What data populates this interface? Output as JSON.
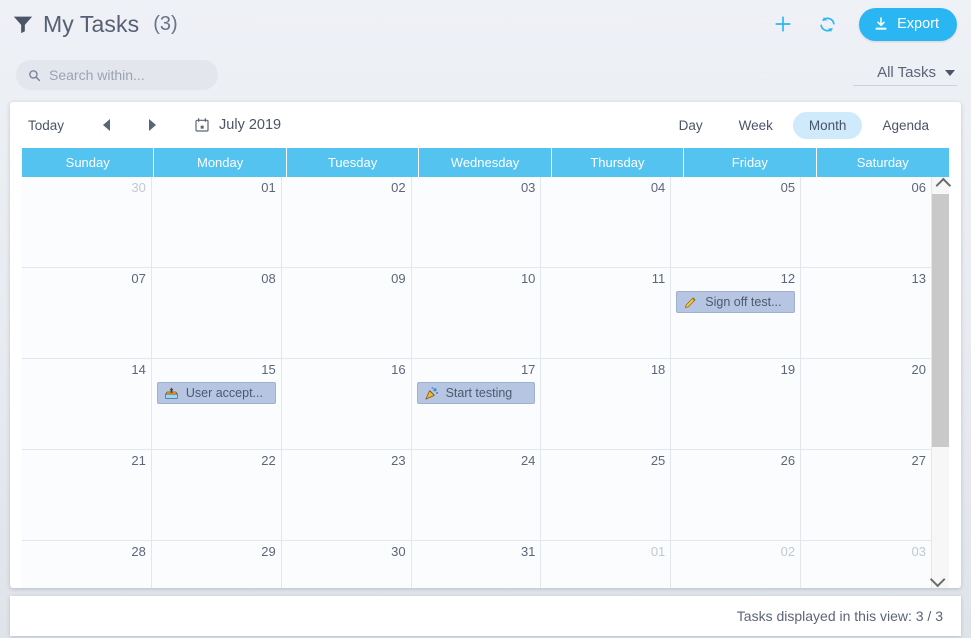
{
  "header": {
    "filter_icon": "funnel-icon",
    "title": "My Tasks",
    "count": "(3)",
    "add_icon": "plus-icon",
    "refresh_icon": "refresh-icon",
    "export_label": "Export",
    "export_icon": "download-icon",
    "accent_color": "#29b6f2"
  },
  "filters": {
    "search_placeholder": "Search within...",
    "search_value": "",
    "search_icon": "search-icon",
    "task_filter_label": "All Tasks",
    "task_filter_caret": "chevron-down-icon"
  },
  "calendar": {
    "today_label": "Today",
    "prev_label": "◄",
    "next_label": "►",
    "date_icon": "calendar-icon",
    "current_label": "July 2019",
    "views": [
      {
        "label": "Day",
        "active": false
      },
      {
        "label": "Week",
        "active": false
      },
      {
        "label": "Month",
        "active": true
      },
      {
        "label": "Agenda",
        "active": false
      }
    ],
    "active_view": "Month",
    "header_color": "#55c3ef",
    "weekdays": [
      "Sunday",
      "Monday",
      "Tuesday",
      "Wednesday",
      "Thursday",
      "Friday",
      "Saturday"
    ],
    "weeks": [
      [
        {
          "day": "30",
          "other_month": true,
          "events": []
        },
        {
          "day": "01",
          "other_month": false,
          "events": []
        },
        {
          "day": "02",
          "other_month": false,
          "events": []
        },
        {
          "day": "03",
          "other_month": false,
          "events": []
        },
        {
          "day": "04",
          "other_month": false,
          "events": []
        },
        {
          "day": "05",
          "other_month": false,
          "events": []
        },
        {
          "day": "06",
          "other_month": false,
          "events": []
        }
      ],
      [
        {
          "day": "07",
          "other_month": false,
          "events": []
        },
        {
          "day": "08",
          "other_month": false,
          "events": []
        },
        {
          "day": "09",
          "other_month": false,
          "events": []
        },
        {
          "day": "10",
          "other_month": false,
          "events": []
        },
        {
          "day": "11",
          "other_month": false,
          "events": []
        },
        {
          "day": "12",
          "other_month": false,
          "events": [
            {
              "title": "Sign off test...",
              "icon": "pencil-icon"
            }
          ]
        },
        {
          "day": "13",
          "other_month": false,
          "events": []
        }
      ],
      [
        {
          "day": "14",
          "other_month": false,
          "events": []
        },
        {
          "day": "15",
          "other_month": false,
          "events": [
            {
              "title": "User accept...",
              "icon": "inbox-icon"
            }
          ]
        },
        {
          "day": "16",
          "other_month": false,
          "events": []
        },
        {
          "day": "17",
          "other_month": false,
          "events": [
            {
              "title": "Start testing",
              "icon": "party-popper-icon"
            }
          ]
        },
        {
          "day": "18",
          "other_month": false,
          "events": []
        },
        {
          "day": "19",
          "other_month": false,
          "events": []
        },
        {
          "day": "20",
          "other_month": false,
          "events": []
        }
      ],
      [
        {
          "day": "21",
          "other_month": false,
          "events": []
        },
        {
          "day": "22",
          "other_month": false,
          "events": []
        },
        {
          "day": "23",
          "other_month": false,
          "events": []
        },
        {
          "day": "24",
          "other_month": false,
          "events": []
        },
        {
          "day": "25",
          "other_month": false,
          "events": []
        },
        {
          "day": "26",
          "other_month": false,
          "events": []
        },
        {
          "day": "27",
          "other_month": false,
          "events": []
        }
      ],
      [
        {
          "day": "28",
          "other_month": false,
          "events": []
        },
        {
          "day": "29",
          "other_month": false,
          "events": []
        },
        {
          "day": "30",
          "other_month": false,
          "events": []
        },
        {
          "day": "31",
          "other_month": false,
          "events": []
        },
        {
          "day": "01",
          "other_month": true,
          "events": []
        },
        {
          "day": "02",
          "other_month": true,
          "events": []
        },
        {
          "day": "03",
          "other_month": true,
          "events": []
        }
      ]
    ]
  },
  "status": {
    "text": "Tasks displayed in this view: 3 / 3"
  }
}
